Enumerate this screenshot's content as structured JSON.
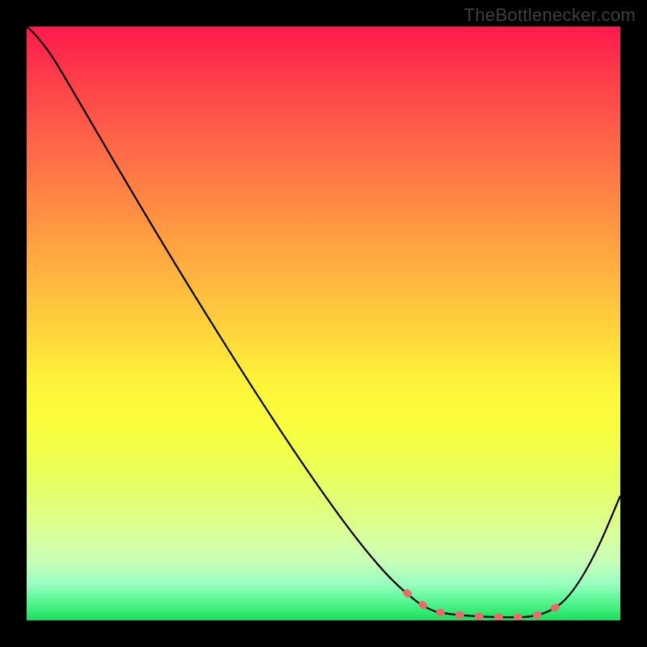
{
  "attribution": "TheBottlenecker.com",
  "chart_data": {
    "type": "line",
    "title": "",
    "xlabel": "",
    "ylabel": "",
    "xlim": [
      0,
      100
    ],
    "ylim": [
      0,
      100
    ],
    "grid": false,
    "background_gradient": {
      "direction": "vertical",
      "stops": [
        {
          "pct": 0,
          "color": "#ff1a4d"
        },
        {
          "pct": 50,
          "color": "#ffd03c"
        },
        {
          "pct": 75,
          "color": "#eaff58"
        },
        {
          "pct": 100,
          "color": "#18e05a"
        }
      ]
    },
    "series": [
      {
        "name": "bottleneck-curve",
        "stroke": "#000000",
        "x": [
          0,
          5,
          10,
          15,
          20,
          25,
          30,
          35,
          40,
          45,
          50,
          55,
          60,
          63,
          66,
          69,
          72,
          75,
          78,
          81,
          84,
          87,
          90,
          93,
          96,
          99,
          100
        ],
        "y": [
          100,
          98,
          94,
          88,
          81,
          73,
          65,
          57,
          49,
          41,
          33,
          25,
          17,
          13,
          10,
          8,
          6,
          5,
          4,
          4,
          4,
          5,
          7,
          11,
          18,
          28,
          32
        ]
      }
    ],
    "markers": {
      "name": "dotted-valley",
      "color": "#ea6a6a",
      "style": "dashed",
      "x": [
        63,
        66,
        69,
        72,
        75,
        78,
        81,
        84,
        87,
        88
      ],
      "y": [
        13,
        10,
        8,
        6,
        5,
        4,
        4,
        4,
        5,
        6
      ]
    }
  }
}
